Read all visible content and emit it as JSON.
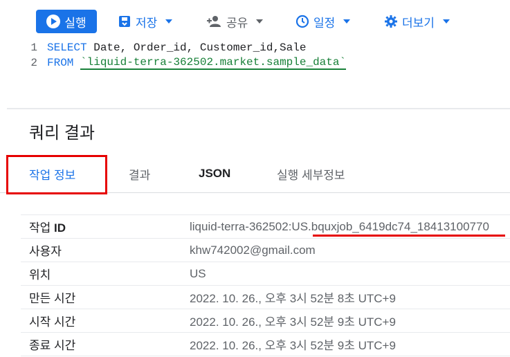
{
  "toolbar": {
    "run_label": "실행",
    "save_label": "저장",
    "share_label": "공유",
    "schedule_label": "일정",
    "more_label": "더보기"
  },
  "editor": {
    "lines": [
      {
        "num": "1",
        "keyword": "SELECT",
        "text": " Date, Order_id, Customer_id,Sale",
        "ref": ""
      },
      {
        "num": "2",
        "keyword": "FROM",
        "text": " ",
        "ref": "`liquid-terra-362502.market.sample_data`"
      }
    ]
  },
  "results": {
    "title": "쿼리 결과",
    "tabs": [
      "작업 정보",
      "결과",
      "JSON",
      "실행 세부정보"
    ],
    "active_tab": "작업 정보"
  },
  "job_info": {
    "rows": [
      {
        "label_prefix": "작업 ",
        "label_bold": "ID",
        "value": "liquid-terra-362502:US.bquxjob_6419dc74_18413100770"
      },
      {
        "label_prefix": "사용자",
        "label_bold": "",
        "value": "khw742002@gmail.com"
      },
      {
        "label_prefix": "위치",
        "label_bold": "",
        "value": "US"
      },
      {
        "label_prefix": "만든 시간",
        "label_bold": "",
        "value": "2022. 10. 26., 오후 3시 52분 8초 UTC+9"
      },
      {
        "label_prefix": "시작 시간",
        "label_bold": "",
        "value": "2022. 10. 26., 오후 3시 52분 9초 UTC+9"
      },
      {
        "label_prefix": "종료 시간",
        "label_bold": "",
        "value": "2022. 10. 26., 오후 3시 52분 9초 UTC+9"
      }
    ]
  },
  "colors": {
    "accent": "#1a73e8",
    "annotation": "#e60000",
    "table_ref": "#188038"
  },
  "icons": [
    "play-icon",
    "save-icon",
    "share-person-icon",
    "schedule-clock-icon",
    "settings-gear-icon",
    "caret-down-icon"
  ]
}
